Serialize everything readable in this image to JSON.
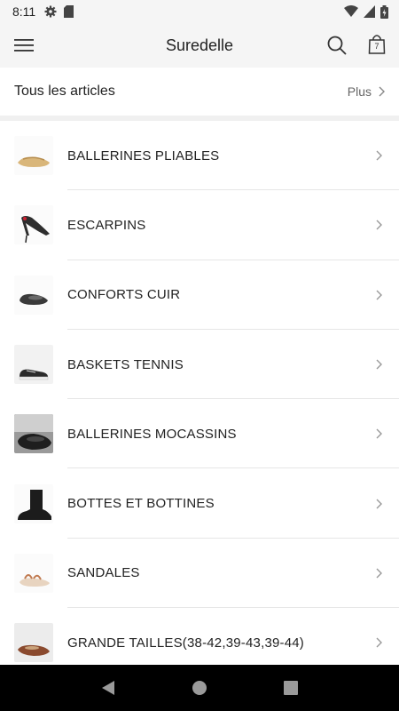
{
  "status_bar": {
    "time": "8:11",
    "icons": [
      "gear-icon",
      "sd-card-icon"
    ],
    "right_icons": [
      "wifi-icon",
      "signal-icon",
      "battery-icon"
    ]
  },
  "app_bar": {
    "title": "Suredelle",
    "cart_count": "7",
    "icons": [
      "menu-icon",
      "search-icon",
      "shopping-bag-icon"
    ]
  },
  "all_articles": {
    "label": "Tous les articles",
    "more_label": "Plus"
  },
  "categories": [
    {
      "name": "BALLERINES PLIABLES",
      "thumb": "beige-ballerina"
    },
    {
      "name": "ESCARPINS",
      "thumb": "black-pump"
    },
    {
      "name": "CONFORTS CUIR",
      "thumb": "dark-loafer"
    },
    {
      "name": "BASKETS TENNIS",
      "thumb": "white-sneaker"
    },
    {
      "name": "BALLERINES MOCASSINS",
      "thumb": "black-mocassin"
    },
    {
      "name": "BOTTES ET BOTTINES",
      "thumb": "black-boot"
    },
    {
      "name": "SANDALES",
      "thumb": "beige-sandal"
    },
    {
      "name": "GRANDE TAILLES(38-42,39-43,39-44)",
      "thumb": "tan-flat"
    }
  ]
}
